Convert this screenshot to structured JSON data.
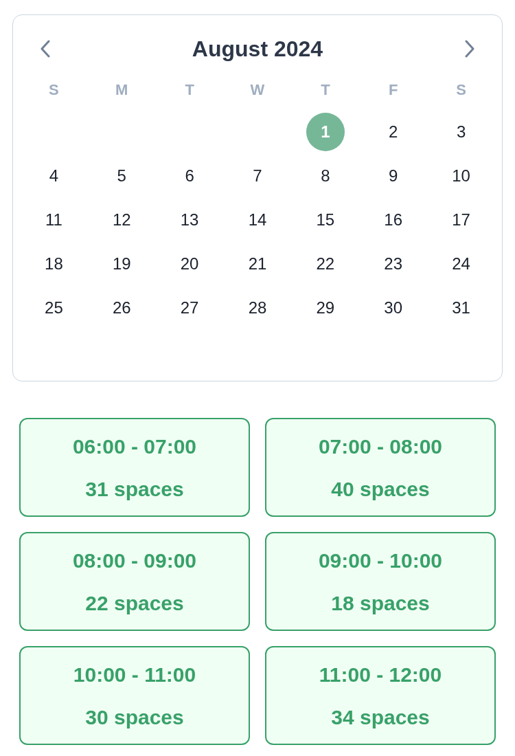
{
  "calendar": {
    "title": "August 2024",
    "weekdays": [
      "S",
      "M",
      "T",
      "W",
      "T",
      "F",
      "S"
    ],
    "weeks": [
      {
        "kind": "leading",
        "days": [
          {
            "label": "1",
            "selected": true
          },
          {
            "label": "2",
            "selected": false
          },
          {
            "label": "3",
            "selected": false
          }
        ]
      },
      {
        "kind": "full",
        "days": [
          {
            "label": "4",
            "selected": false
          },
          {
            "label": "5",
            "selected": false
          },
          {
            "label": "6",
            "selected": false
          },
          {
            "label": "7",
            "selected": false
          },
          {
            "label": "8",
            "selected": false
          },
          {
            "label": "9",
            "selected": false
          },
          {
            "label": "10",
            "selected": false
          }
        ]
      },
      {
        "kind": "full",
        "days": [
          {
            "label": "11",
            "selected": false
          },
          {
            "label": "12",
            "selected": false
          },
          {
            "label": "13",
            "selected": false
          },
          {
            "label": "14",
            "selected": false
          },
          {
            "label": "15",
            "selected": false
          },
          {
            "label": "16",
            "selected": false
          },
          {
            "label": "17",
            "selected": false
          }
        ]
      },
      {
        "kind": "full",
        "days": [
          {
            "label": "18",
            "selected": false
          },
          {
            "label": "19",
            "selected": false
          },
          {
            "label": "20",
            "selected": false
          },
          {
            "label": "21",
            "selected": false
          },
          {
            "label": "22",
            "selected": false
          },
          {
            "label": "23",
            "selected": false
          },
          {
            "label": "24",
            "selected": false
          }
        ]
      },
      {
        "kind": "full",
        "days": [
          {
            "label": "25",
            "selected": false
          },
          {
            "label": "26",
            "selected": false
          },
          {
            "label": "27",
            "selected": false
          },
          {
            "label": "28",
            "selected": false
          },
          {
            "label": "29",
            "selected": false
          },
          {
            "label": "30",
            "selected": false
          },
          {
            "label": "31",
            "selected": false
          }
        ]
      }
    ]
  },
  "time_slots": [
    {
      "time": "06:00 - 07:00",
      "spaces": "31 spaces"
    },
    {
      "time": "07:00 - 08:00",
      "spaces": "40 spaces"
    },
    {
      "time": "08:00 - 09:00",
      "spaces": "22 spaces"
    },
    {
      "time": "09:00 - 10:00",
      "spaces": "18 spaces"
    },
    {
      "time": "10:00 - 11:00",
      "spaces": "30 spaces"
    },
    {
      "time": "11:00 - 12:00",
      "spaces": "34 spaces"
    }
  ]
}
